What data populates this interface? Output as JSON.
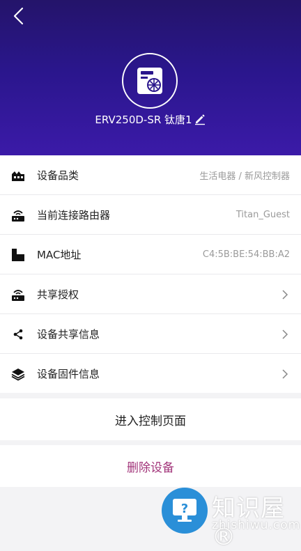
{
  "header": {
    "device_name": "ERV250D-SR 钛唐1",
    "colors": {
      "gradient_top": "#24146a",
      "gradient_bottom": "#3b1aa8"
    }
  },
  "info_rows": [
    {
      "icon": "category-icon",
      "label": "设备品类",
      "value": "生活电器 / 新风控制器"
    },
    {
      "icon": "router-icon",
      "label": "当前连接路由器",
      "value": "Titan_Guest"
    },
    {
      "icon": "mac-icon",
      "label": "MAC地址",
      "value": "C4:5B:BE:54:BB:A2"
    },
    {
      "icon": "router-icon",
      "label": "共享授权",
      "value": ""
    },
    {
      "icon": "share-icon",
      "label": "设备共享信息",
      "value": ""
    },
    {
      "icon": "layers-icon",
      "label": "设备固件信息",
      "value": ""
    }
  ],
  "actions": {
    "control_label": "进入控制页面",
    "delete_label": "删除设备",
    "delete_color": "#a2357a"
  },
  "watermark": {
    "title": "知识屋®",
    "subtitle": "zhishiwu.com"
  }
}
